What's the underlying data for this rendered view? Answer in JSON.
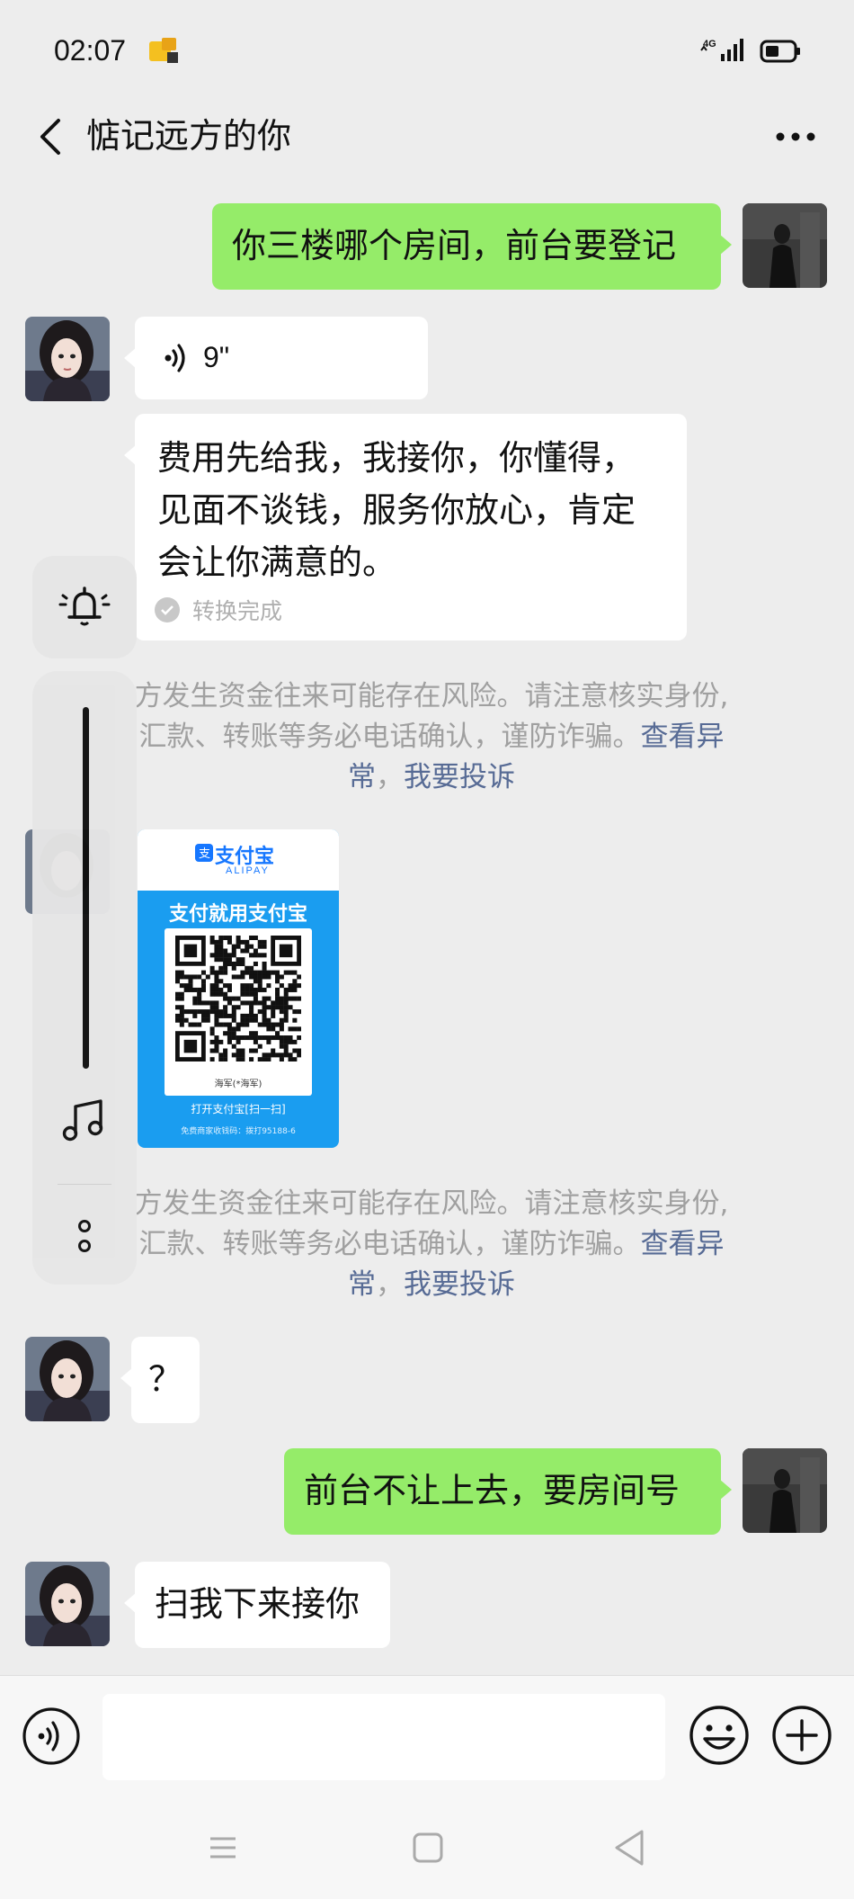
{
  "status_bar": {
    "time": "02:07"
  },
  "header": {
    "title": "惦记远方的你"
  },
  "messages": {
    "m1": {
      "text": "你三楼哪个房间，前台要登记"
    },
    "m2": {
      "duration": "9\""
    },
    "m3": {
      "lines": [
        "费用先给我，我接你，你懂得，",
        "见面不谈钱，服务你放心，肯定",
        "会让你满意的。"
      ],
      "status": "转换完成"
    },
    "m4": {
      "brand": "支付宝",
      "brand_en": "ALIPAY",
      "slogan": "支付就用支付宝",
      "payee": "海军(*海军)",
      "open_text": "打开支付宝[扫一扫]",
      "hint": "免费商家收钱码：拨打95188-6"
    },
    "m5": {
      "text": "？"
    },
    "m6": {
      "text": "前台不让上去，要房间号"
    },
    "m7": {
      "text": "扫我下来接你"
    }
  },
  "notices": {
    "line1": "方发生资金往来可能存在风险。请注意核实身份,",
    "line2_prefix": "汇款、转账等务必电话确认，谨防诈骗。",
    "line2_link": "查看异",
    "line3_link_a": "常",
    "line3_sep": "，",
    "line3_link_b": "我要投诉"
  },
  "input": {
    "value": ""
  },
  "colors": {
    "background": "#ededed",
    "sent_bubble": "#95ec69",
    "received_bubble": "#ffffff",
    "link": "#576b95",
    "notice_text": "#a0a0a0"
  },
  "icons": [
    "app-notification-icon",
    "signal-4g-icon",
    "battery-icon",
    "back-arrow-icon",
    "more-dots-icon",
    "voice-wave-icon",
    "bell-icon",
    "music-note-icon",
    "vertical-dots-icon",
    "voice-input-icon",
    "emoji-icon",
    "plus-icon",
    "nav-menu-icon",
    "nav-home-icon",
    "nav-back-icon"
  ]
}
